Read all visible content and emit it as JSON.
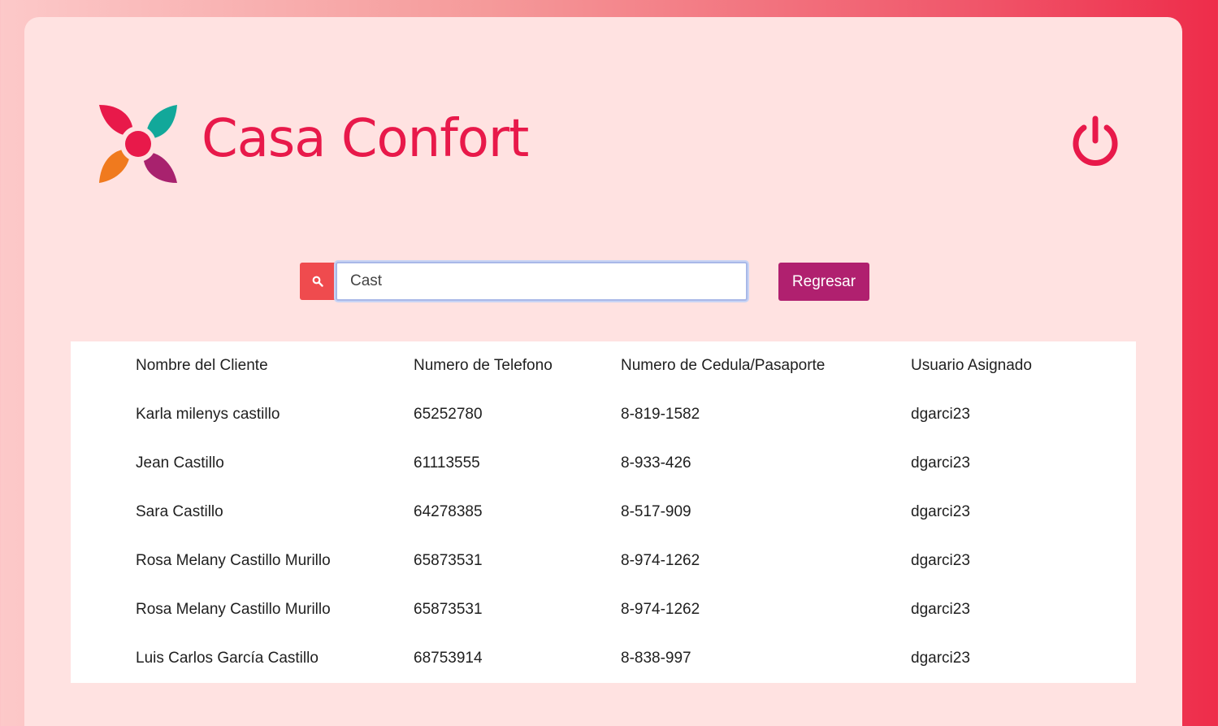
{
  "brand": {
    "name": "Casa Confort"
  },
  "search": {
    "value": "Cast",
    "placeholder": ""
  },
  "actions": {
    "back_label": "Regresar"
  },
  "table": {
    "headers": [
      "Nombre del Cliente",
      "Numero de Telefono",
      "Numero de Cedula/Pasaporte",
      "Usuario Asignado"
    ],
    "rows": [
      [
        "Karla milenys castillo",
        "65252780",
        "8-819-1582",
        "dgarci23"
      ],
      [
        "Jean Castillo",
        "61113555",
        "8-933-426",
        "dgarci23"
      ],
      [
        "Sara Castillo",
        "64278385",
        "8-517-909",
        "dgarci23"
      ],
      [
        "Rosa Melany Castillo Murillo",
        "65873531",
        "8-974-1262",
        "dgarci23"
      ],
      [
        "Rosa Melany Castillo Murillo",
        "65873531",
        "8-974-1262",
        "dgarci23"
      ],
      [
        "Luis Carlos García Castillo",
        "68753914",
        "8-838-997",
        "dgarci23"
      ]
    ]
  },
  "colors": {
    "brand": "#e8194a",
    "search_button": "#ef4b4e",
    "back_button": "#b0206f",
    "card_background": "#ffe2e1"
  },
  "icons": {
    "logo": "flower-logo-icon",
    "logout": "power-icon",
    "search": "search-icon"
  }
}
